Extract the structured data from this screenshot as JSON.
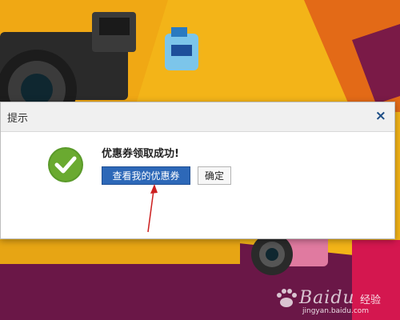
{
  "dialog": {
    "title": "提示",
    "close_glyph": "×",
    "message": "优惠券领取成功!",
    "primary_button": "查看我的优惠券",
    "ok_button": "确定",
    "icon": "check-circle-icon"
  },
  "watermark": {
    "brand": "Baidu",
    "brand_cn": "经验",
    "url": "jingyan.baidu.com"
  },
  "colors": {
    "background_yellow": "#f3b418",
    "background_purple": "#6a1747",
    "success_green": "#5a9a2a",
    "primary_blue": "#2d68b8",
    "arrow_red": "#cc1f1f"
  }
}
